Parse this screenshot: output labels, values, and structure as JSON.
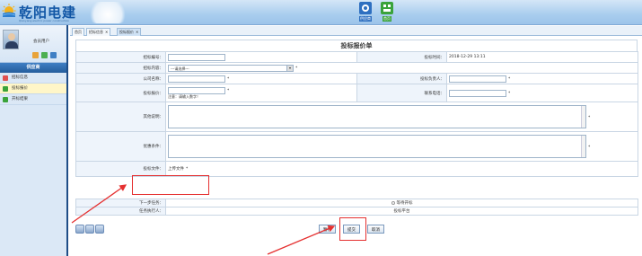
{
  "app": {
    "logo_title": "乾阳电建",
    "logo_subtitle": "Qianyang electric power construction",
    "top_nav": [
      {
        "label": "供应商",
        "icon": "supplier-icon",
        "color": "#2e6fc0"
      },
      {
        "label": "首页",
        "icon": "home-grid-icon",
        "color": "#3aa33a"
      }
    ]
  },
  "sidebar": {
    "user_name": "会员用户",
    "section_title": "供应商",
    "items": [
      {
        "label": "招标信息",
        "color": "#e05050"
      },
      {
        "label": "投标报价",
        "color": "#3aa33a"
      },
      {
        "label": "开标结果",
        "color": "#3aa33a"
      }
    ]
  },
  "tabs": [
    {
      "label": "首页",
      "closable": false
    },
    {
      "label": "招标信息",
      "closable": true
    },
    {
      "label": "投标报价",
      "closable": true
    }
  ],
  "form": {
    "title": "投标报价单",
    "fields": {
      "bid_no_label": "招标编号：",
      "bid_time_label": "投标时间：",
      "bid_time_value": "2018-12-29 13:11",
      "content_label": "招标内容：",
      "content_placeholder": "---请选择---",
      "company_label": "公司名称：",
      "bid_person_label": "投标负责人：",
      "price_label": "投标报价：",
      "price_note": "注意：请输入数字！",
      "phone_label": "联系电话：",
      "other_label": "其他说明：",
      "discount_label": "优惠条件：",
      "file_label": "投标文件：",
      "file_link": "上传文件",
      "required_mark": "*"
    },
    "flow": {
      "next_task_label": "下一步任务：",
      "next_task_value": "等待开标",
      "executor_label": "任务执行人：",
      "executor_value": "投标平台"
    },
    "buttons": {
      "save": "暂存",
      "submit": "提交",
      "cancel": "取消"
    }
  },
  "colors": {
    "annotation": "#e53030",
    "accent": "#245d9c"
  }
}
